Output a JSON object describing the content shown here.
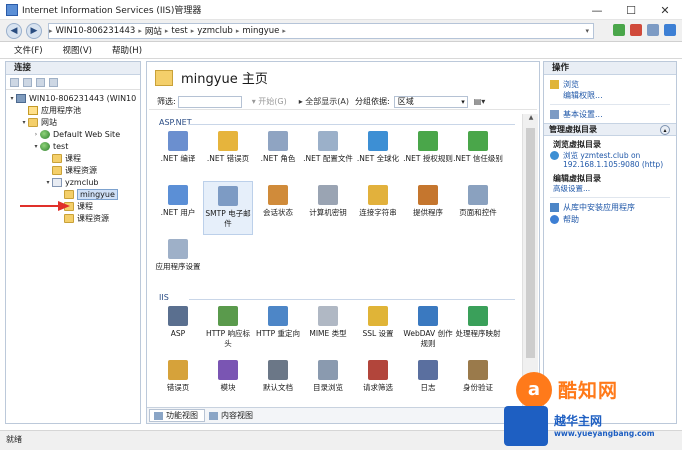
{
  "window": {
    "title": "Internet Information Services (IIS)管理器",
    "controls": [
      "—",
      "☐",
      "✕"
    ]
  },
  "address": {
    "crumbs": [
      "WIN10-806231443",
      "网站",
      "test",
      "yzmclub",
      "mingyue"
    ],
    "sep": "▸",
    "dropdown": "▾"
  },
  "menu": [
    "文件(F)",
    "视图(V)",
    "帮助(H)"
  ],
  "connections": {
    "title": "连接",
    "tree": [
      {
        "label": "WIN10-806231443 (WIN10",
        "toggle": "▾",
        "icon": "server",
        "indent": 0
      },
      {
        "label": "应用程序池",
        "toggle": "",
        "icon": "pool",
        "indent": 1
      },
      {
        "label": "网站",
        "toggle": "▾",
        "icon": "folder",
        "indent": 1
      },
      {
        "label": "Default Web Site",
        "toggle": "›",
        "icon": "globe",
        "indent": 2
      },
      {
        "label": "test",
        "toggle": "▾",
        "icon": "globe",
        "indent": 2
      },
      {
        "label": "课程",
        "toggle": "",
        "icon": "folder",
        "indent": 3
      },
      {
        "label": "课程资源",
        "toggle": "",
        "icon": "folder",
        "indent": 3
      },
      {
        "label": "yzmclub",
        "toggle": "▾",
        "icon": "app",
        "indent": 3
      },
      {
        "label": "mingyue",
        "toggle": "",
        "icon": "folder",
        "indent": 4,
        "selected": true
      },
      {
        "label": "课程",
        "toggle": "",
        "icon": "folder",
        "indent": 4
      },
      {
        "label": "课程资源",
        "toggle": "",
        "icon": "folder",
        "indent": 4
      }
    ]
  },
  "page": {
    "title": "mingyue 主页",
    "filter_label": "筛选:",
    "start_label": "开始(G)",
    "show_all_label": "全部显示(A)",
    "group_label": "分组依据:",
    "group_value": "区域",
    "groups": [
      {
        "name": "ASP.NET",
        "items": [
          {
            "label": ".NET 编译",
            "color": "#6b8fcf"
          },
          {
            "label": ".NET 错误页",
            "color": "#e6b43c"
          },
          {
            "label": ".NET 角色",
            "color": "#8fa4c2"
          },
          {
            "label": ".NET 配置文件",
            "color": "#9bb0c9"
          },
          {
            "label": ".NET 全球化",
            "color": "#3d8fd4"
          },
          {
            "label": ".NET 授权规则",
            "color": "#4aa64a"
          },
          {
            "label": ".NET 信任级别",
            "color": "#4aa64a"
          },
          {
            "label": ".NET 用户",
            "color": "#5b8fd6"
          },
          {
            "label": "SMTP 电子邮件",
            "color": "#7d9bc4",
            "hl": true
          },
          {
            "label": "会话状态",
            "color": "#d08b3a"
          },
          {
            "label": "计算机密钥",
            "color": "#9aa4b3"
          },
          {
            "label": "连接字符串",
            "color": "#e2b13c"
          },
          {
            "label": "提供程序",
            "color": "#c5762e"
          },
          {
            "label": "页面和控件",
            "color": "#8aa1bf"
          },
          {
            "label": "应用程序设置",
            "color": "#9eb0c8"
          }
        ]
      },
      {
        "name": "IIS",
        "items": [
          {
            "label": "ASP",
            "color": "#5a6f8f"
          },
          {
            "label": "HTTP 响应标头",
            "color": "#5a9a4c"
          },
          {
            "label": "HTTP 重定向",
            "color": "#4d86c7"
          },
          {
            "label": "MIME 类型",
            "color": "#b0b8c4"
          },
          {
            "label": "SSL 设置",
            "color": "#e0b437"
          },
          {
            "label": "WebDAV 创作规则",
            "color": "#3a79c0"
          },
          {
            "label": "处理程序映射",
            "color": "#3aa05a"
          },
          {
            "label": "错误页",
            "color": "#d6a23a"
          },
          {
            "label": "模块",
            "color": "#7a55b3"
          },
          {
            "label": "默认文档",
            "color": "#6b7787"
          },
          {
            "label": "目录浏览",
            "color": "#8a9aaf"
          },
          {
            "label": "请求筛选",
            "color": "#b2453b"
          },
          {
            "label": "日志",
            "color": "#5a6f9f"
          },
          {
            "label": "身份验证",
            "color": "#9a7a4b"
          }
        ]
      }
    ],
    "tabs": [
      "功能视图",
      "内容视图"
    ]
  },
  "actions": {
    "title": "操作",
    "top": [
      {
        "label": "浏览",
        "color": "#e0b437"
      },
      {
        "label": "编辑权限...",
        "sub": true
      }
    ],
    "basic": {
      "label": "基本设置...",
      "color": "#7d9bc4"
    },
    "vdir_title": "管理虚拟目录",
    "vdir_caret": "▴",
    "browse_vdir_title": "浏览虚拟目录",
    "browse_vdir_line1": "浏览 yzmtest.club on",
    "browse_vdir_line2": "192.168.1.105:9080 (http)",
    "edit_vdir_title": "编辑虚拟目录",
    "edit_vdir_link": "高级设置...",
    "gallery_link": "从库中安装应用程序",
    "help_link": "帮助"
  },
  "status": "就绪",
  "watermark": {
    "brand": "酷知网",
    "logo_a": "a",
    "site": "越华主网",
    "url": "www.yueyangbang.com"
  }
}
